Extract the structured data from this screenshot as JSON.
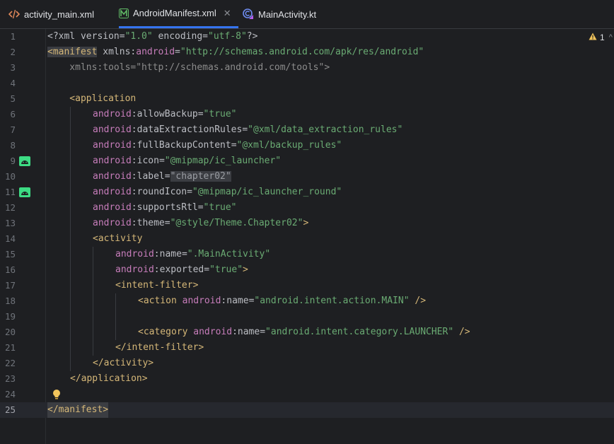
{
  "tabs": [
    {
      "label": "activity_main.xml",
      "icon": "xml-layout-icon"
    },
    {
      "label": "AndroidManifest.xml",
      "icon": "manifest-icon",
      "active": true
    },
    {
      "label": "MainActivity.kt",
      "icon": "kotlin-class-icon"
    }
  ],
  "close_glyph": "✕",
  "inspections": {
    "warning_count": "1",
    "warning_icon": "warning-icon",
    "nav_up_glyph": "^"
  },
  "lines": [
    {
      "n": "1"
    },
    {
      "n": "2"
    },
    {
      "n": "3"
    },
    {
      "n": "4"
    },
    {
      "n": "5"
    },
    {
      "n": "6"
    },
    {
      "n": "7"
    },
    {
      "n": "8"
    },
    {
      "n": "9"
    },
    {
      "n": "10"
    },
    {
      "n": "11"
    },
    {
      "n": "12"
    },
    {
      "n": "13"
    },
    {
      "n": "14"
    },
    {
      "n": "15"
    },
    {
      "n": "16"
    },
    {
      "n": "17"
    },
    {
      "n": "18"
    },
    {
      "n": "19"
    },
    {
      "n": "20"
    },
    {
      "n": "21"
    },
    {
      "n": "22"
    },
    {
      "n": "23"
    },
    {
      "n": "24"
    },
    {
      "n": "25"
    }
  ],
  "code": {
    "l1": {
      "a": "<?xml version=",
      "b": "\"1.0\"",
      "c": " encoding=",
      "d": "\"utf-8\"",
      "e": "?>"
    },
    "l2": {
      "a": "<manifest",
      "b": " xmlns:",
      "c": "android",
      "d": "=",
      "e": "\"http://schemas.android.com/apk/res/android\""
    },
    "l3": {
      "a": "    xmlns:tools=\"http://schemas.android.com/tools\">"
    },
    "l5": {
      "a": "    <application"
    },
    "l6": {
      "ns": "android",
      ":": ":",
      "attr": "allowBackup",
      "eq": "=",
      "val": "\"true\""
    },
    "l7": {
      "ns": "android",
      ":": ":",
      "attr": "dataExtractionRules",
      "eq": "=",
      "val": "\"@xml/data_extraction_rules\""
    },
    "l8": {
      "ns": "android",
      ":": ":",
      "attr": "fullBackupContent",
      "eq": "=",
      "val": "\"@xml/backup_rules\""
    },
    "l9": {
      "ns": "android",
      ":": ":",
      "attr": "icon",
      "eq": "=",
      "val": "\"@mipmap/ic_launcher\""
    },
    "l10": {
      "ns": "android",
      ":": ":",
      "attr": "label",
      "eq": "=",
      "val": "\"chapter02\""
    },
    "l11": {
      "ns": "android",
      ":": ":",
      "attr": "roundIcon",
      "eq": "=",
      "val": "\"@mipmap/ic_launcher_round\""
    },
    "l12": {
      "ns": "android",
      ":": ":",
      "attr": "supportsRtl",
      "eq": "=",
      "val": "\"true\""
    },
    "l13": {
      "ns": "android",
      ":": ":",
      "attr": "theme",
      "eq": "=",
      "val": "\"@style/Theme.Chapter02\"",
      "end": ">"
    },
    "l14": {
      "a": "<activity"
    },
    "l15": {
      "ns": "android",
      ":": ":",
      "attr": "name",
      "eq": "=",
      "val": "\".MainActivity\""
    },
    "l16": {
      "ns": "android",
      ":": ":",
      "attr": "exported",
      "eq": "=",
      "val": "\"true\"",
      "end": ">"
    },
    "l17": {
      "a": "<intent-filter>"
    },
    "l18": {
      "a": "<action ",
      "ns": "android",
      ":": ":",
      "attr": "name",
      "eq": "=",
      "val": "\"android.intent.action.MAIN\"",
      "end": " />"
    },
    "l20": {
      "a": "<category ",
      "ns": "android",
      ":": ":",
      "attr": "name",
      "eq": "=",
      "val": "\"android.intent.category.LAUNCHER\"",
      "end": " />"
    },
    "l21": {
      "a": "</intent-filter>"
    },
    "l22": {
      "a": "</activity>"
    },
    "l23": {
      "a": "</application>"
    },
    "l25": {
      "a": "</manifest>"
    }
  },
  "gutter_icons": {
    "l9": "android-icon",
    "l11": "android-icon",
    "l24": "lightbulb-icon"
  },
  "colors": {
    "accent": "#3574f0",
    "android_green": "#3ddc84",
    "tag": "#d5b778",
    "namespace": "#c77dbb",
    "string": "#6aab73"
  }
}
